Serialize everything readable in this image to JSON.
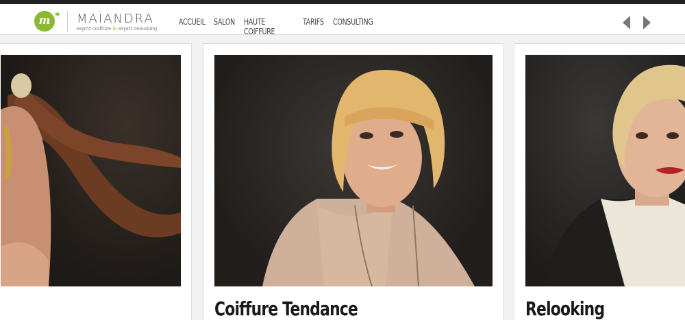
{
  "brand": {
    "mark": "m",
    "name": "MAÏANDRA",
    "tagline_part1": "esprit coiffure",
    "tagline_amp": "&",
    "tagline_part2": "esprit relooking"
  },
  "nav": {
    "items": [
      "ACCUEIL",
      "SALON",
      "HAUTE COIFFURE",
      "TARIFS",
      "CONSULTING"
    ]
  },
  "slider": {
    "prev_icon": "arrow-left-icon",
    "next_icon": "arrow-right-icon"
  },
  "cards": [
    {
      "title": ""
    },
    {
      "title": "Coiffure Tendance"
    },
    {
      "title": "Relooking"
    }
  ],
  "colors": {
    "accent": "#8ab833",
    "topbar": "#222222"
  }
}
